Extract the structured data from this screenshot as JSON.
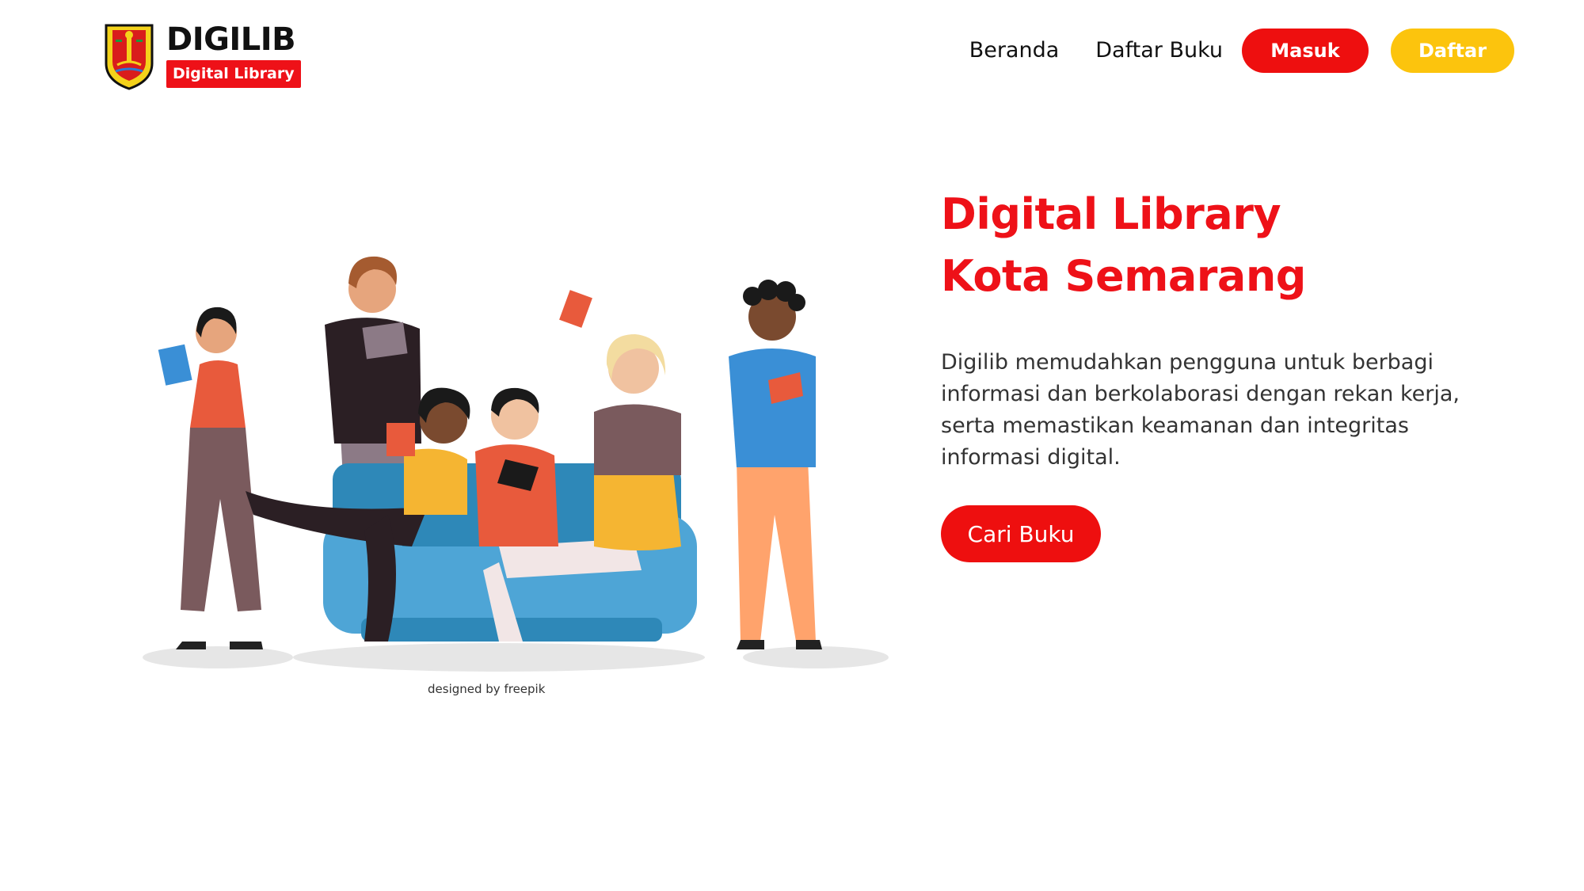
{
  "brand": {
    "title": "DIGILIB",
    "subtitle": "Digital Library",
    "emblem_icon": "city-emblem-icon"
  },
  "nav": {
    "home": "Beranda",
    "books": "Daftar Buku",
    "login": "Masuk",
    "register": "Daftar"
  },
  "hero": {
    "title_line1": "Digital Library",
    "title_line2": "Kota Semarang",
    "description": "Digilib memudahkan pengguna untuk berbagi informasi dan berkolaborasi dengan rekan kerja, serta memastikan keamanan dan integritas informasi digital.",
    "cta": "Cari Buku",
    "illustration_credit": "designed by freepik"
  },
  "colors": {
    "accent_red": "#ee1118",
    "accent_yellow": "#fcc40d",
    "background": "#ffffff"
  }
}
